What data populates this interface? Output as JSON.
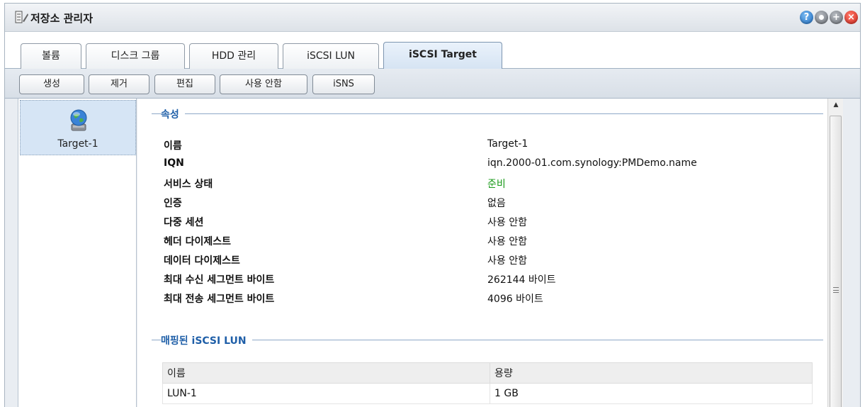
{
  "window": {
    "title": "저장소 관리자"
  },
  "tabs": [
    {
      "label": "볼륨"
    },
    {
      "label": "디스크 그룹"
    },
    {
      "label": "HDD 관리"
    },
    {
      "label": "iSCSI LUN"
    },
    {
      "label": "iSCSI Target",
      "active": true
    }
  ],
  "toolbar": {
    "create": "생성",
    "remove": "제거",
    "edit": "편집",
    "disable": "사용 안함",
    "isns": "iSNS"
  },
  "sidebar": {
    "items": [
      {
        "label": "Target-1",
        "icon": "globe-target-icon"
      }
    ]
  },
  "properties": {
    "title": "속성",
    "rows": [
      {
        "label": "이름",
        "value": "Target-1"
      },
      {
        "label": "IQN",
        "value": "iqn.2000-01.com.synology:PMDemo.name"
      },
      {
        "label": "서비스 상태",
        "value": "준비",
        "status_color": "#1a9a1a"
      },
      {
        "label": "인증",
        "value": "없음"
      },
      {
        "label": "다중 세션",
        "value": "사용 안함"
      },
      {
        "label": "헤더 다이제스트",
        "value": "사용 안함"
      },
      {
        "label": "데이터 다이제스트",
        "value": "사용 안함"
      },
      {
        "label": "최대 수신 세그먼트 바이트",
        "value": "262144 바이트"
      },
      {
        "label": "최대 전송 세그먼트 바이트",
        "value": "4096 바이트"
      }
    ]
  },
  "mapped_luns": {
    "title": "매핑된 iSCSI LUN",
    "columns": [
      "이름",
      "용량"
    ],
    "rows": [
      [
        "LUN-1",
        "1 GB"
      ]
    ]
  },
  "colors": {
    "section_title": "#1f5fa8",
    "selected_item": "#d6e5f5",
    "close_button": "#d1241a",
    "help_button": "#1f6fc4"
  }
}
